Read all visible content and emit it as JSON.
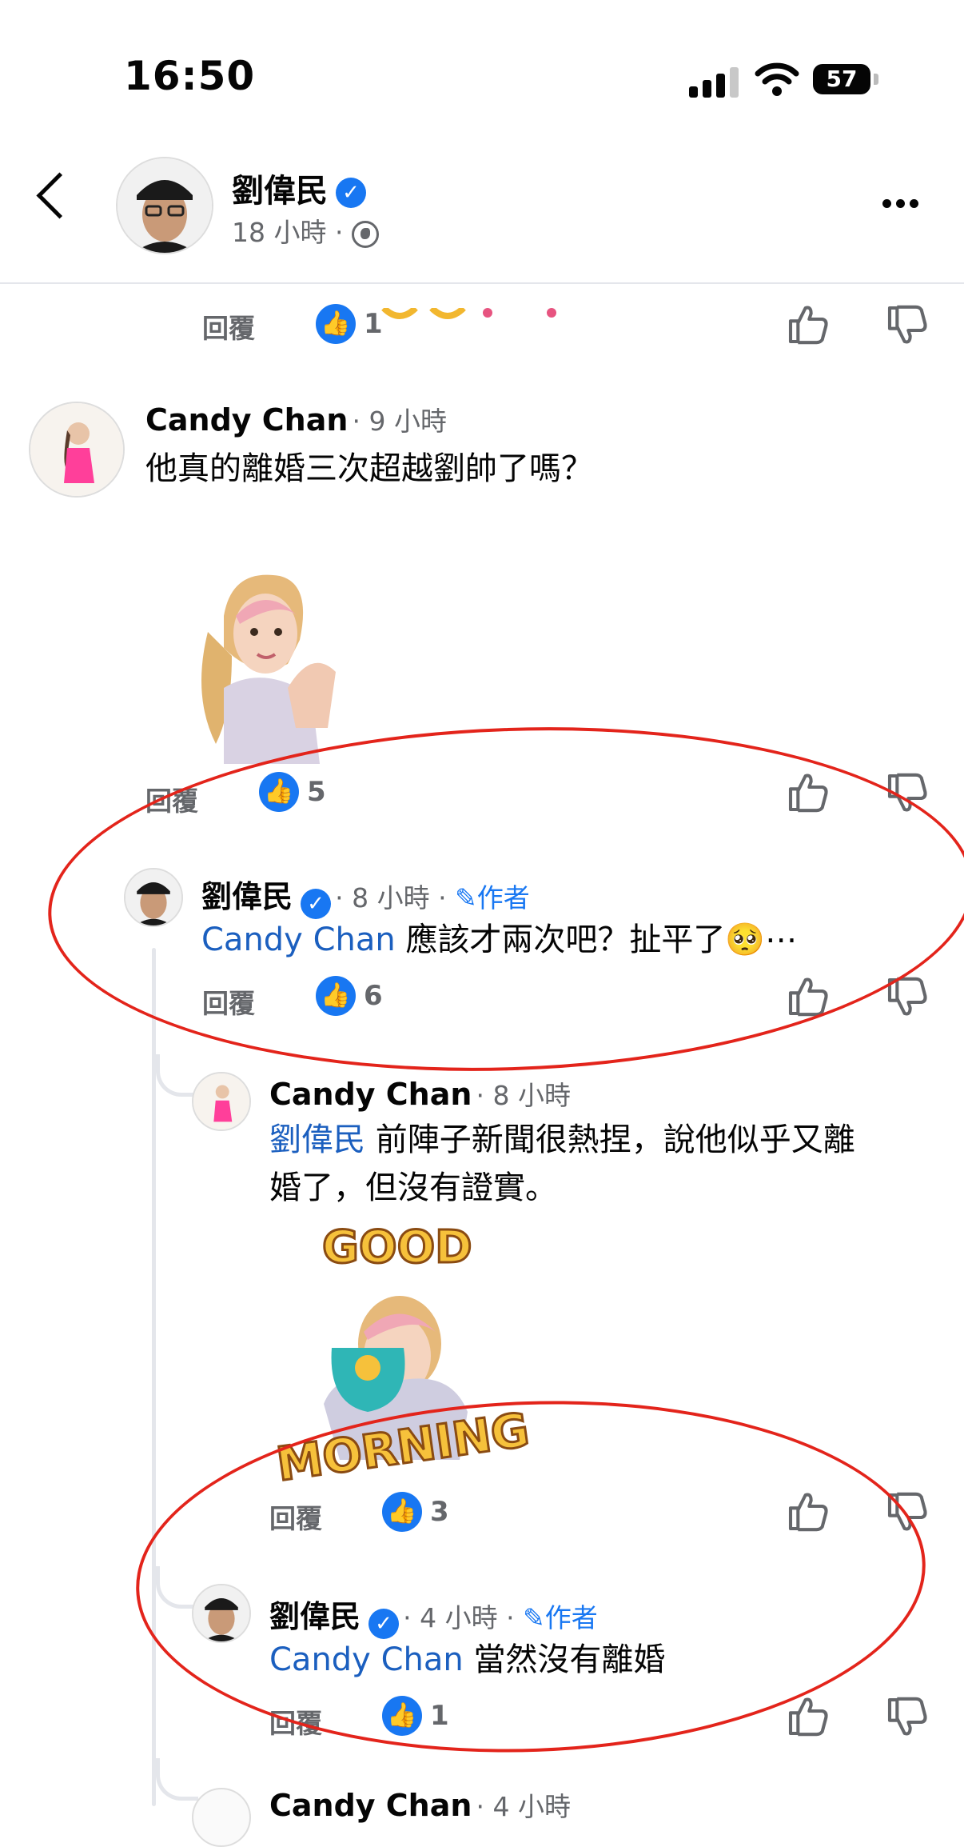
{
  "status_bar": {
    "time": "16:50",
    "battery": "57"
  },
  "header": {
    "name": "劉偉民",
    "time": "18 小時",
    "separator": "·"
  },
  "top_comment": {
    "reply": "回覆",
    "likes": "1"
  },
  "comments": [
    {
      "author": "Candy Chan",
      "time": "9 小時",
      "text": "他真的離婚三次超越劉帥了嗎？",
      "reply": "回覆",
      "likes": "5"
    },
    {
      "author": "劉偉民",
      "time": "8 小時",
      "author_badge": "作者",
      "mention": "Candy Chan",
      "text": "應該才兩次吧？扯平了🥺⋯",
      "reply": "回覆",
      "likes": "6"
    },
    {
      "author": "Candy Chan",
      "time": "8 小時",
      "mention": "劉偉民",
      "text_line1": "前陣子新聞很熱捏，說他似乎又離",
      "text_line2": "婚了，但沒有證實。",
      "sticker_top": "GOOD",
      "sticker_bottom": "MORNING",
      "reply": "回覆",
      "likes": "3"
    },
    {
      "author": "劉偉民",
      "time": "4 小時",
      "author_badge": "作者",
      "mention": "Candy Chan",
      "text": "當然沒有離婚",
      "reply": "回覆",
      "likes": "1"
    },
    {
      "author": "Candy Chan",
      "time": "4 小時"
    }
  ],
  "icons": [
    "back-icon",
    "verified-icon",
    "globe-icon",
    "more-icon",
    "like-icon",
    "thumbs-up-icon",
    "thumbs-down-icon",
    "edit-icon"
  ],
  "colors": {
    "accent": "#1877f2",
    "annotation": "#e3241b",
    "mention": "#1b5fbf"
  }
}
